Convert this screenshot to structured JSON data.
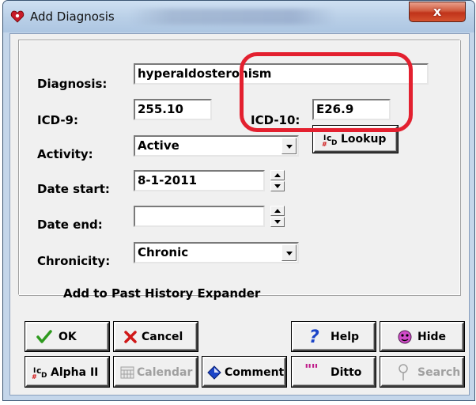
{
  "window": {
    "title": "Add Diagnosis",
    "close_glyph": "x"
  },
  "form": {
    "diagnosis": {
      "label": "Diagnosis:",
      "value": "hyperaldosteronism"
    },
    "icd9": {
      "label": "ICD-9:",
      "value": "255.10"
    },
    "icd10": {
      "label": "ICD-10:",
      "value": "E26.9",
      "lookup_button": "Lookup"
    },
    "activity": {
      "label": "Activity:",
      "value": "Active"
    },
    "date_start": {
      "label": "Date start:",
      "value": "8-1-2011"
    },
    "date_end": {
      "label": "Date end:",
      "value": ""
    },
    "chronicity": {
      "label": "Chronicity:",
      "value": "Chronic"
    }
  },
  "checkbox": {
    "label": "Add to Past History Expander",
    "checked": false
  },
  "buttons": {
    "ok": "OK",
    "cancel": "Cancel",
    "help": "Help",
    "hide": "Hide",
    "alpha": "Alpha II",
    "calendar": "Calendar",
    "comment": "Comment",
    "ditto": "Ditto",
    "search": "Search"
  },
  "icons": {
    "app": "heart-icon",
    "ok": "checkmark-icon",
    "cancel": "x-icon",
    "help": "question-icon",
    "hide": "pink-face-icon",
    "alpha": "icd-icon",
    "calendar": "calendar-icon",
    "comment": "diamond-icon",
    "ditto": "quote-marks-icon",
    "search": "magnifier-icon"
  },
  "colors": {
    "highlight": "#e3202f",
    "titlebar": "#b9cfe7",
    "close_button": "#c0331a"
  }
}
